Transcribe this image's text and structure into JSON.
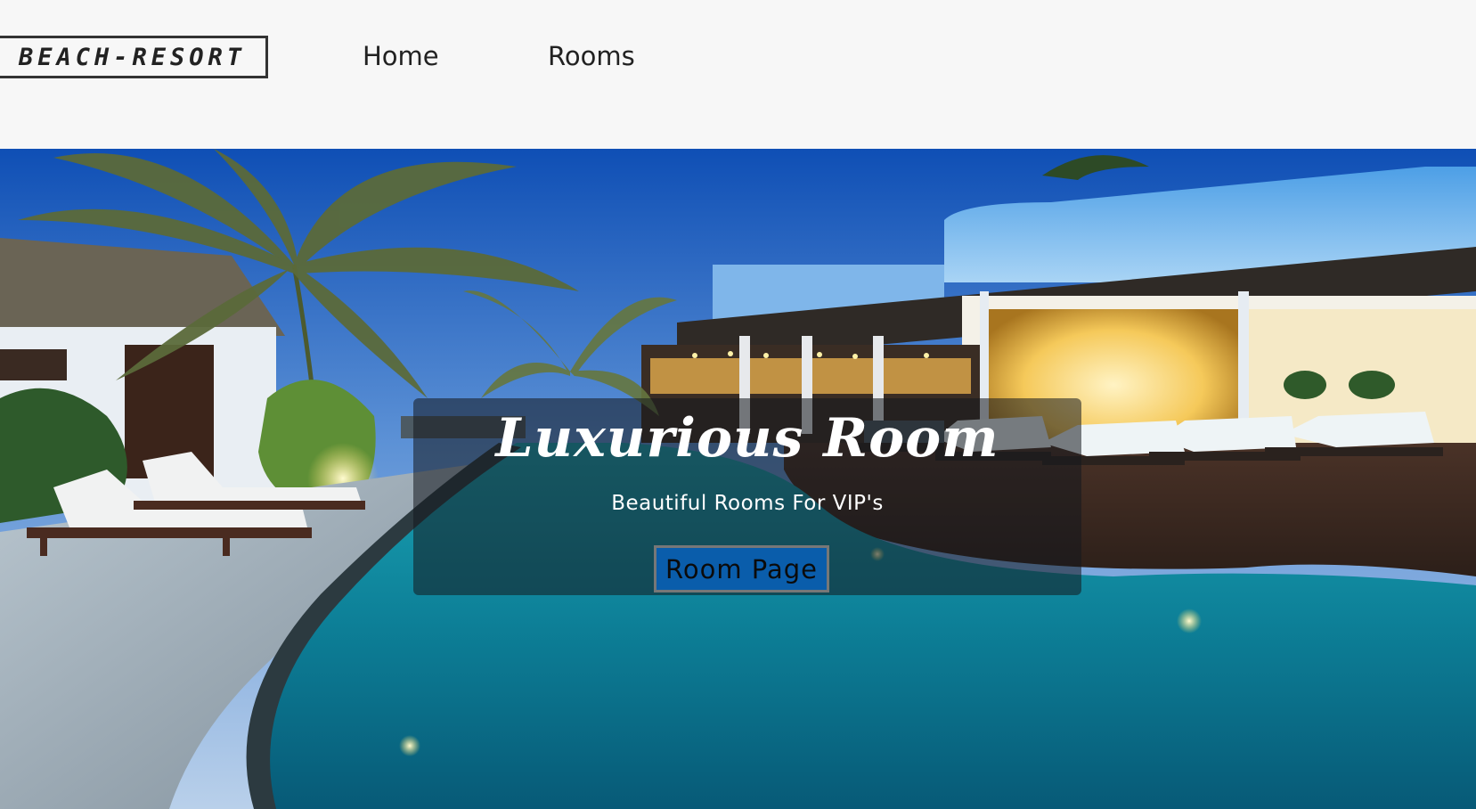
{
  "navbar": {
    "logo_text": "BEACH-RESORT",
    "links": [
      {
        "label": "Home"
      },
      {
        "label": "Rooms"
      }
    ]
  },
  "hero": {
    "background": "beach-resort-pool-photo",
    "banner": {
      "title": "Luxurious Room",
      "subtitle": "Beautiful Rooms For VIP's",
      "button_label": "Room Page"
    }
  },
  "colors": {
    "page_background": "#f7f7f7",
    "button_background": "#0a5dab",
    "banner_overlay": "rgba(20,24,30,0.55)",
    "text_dark": "#222222",
    "text_light": "#ffffff"
  }
}
